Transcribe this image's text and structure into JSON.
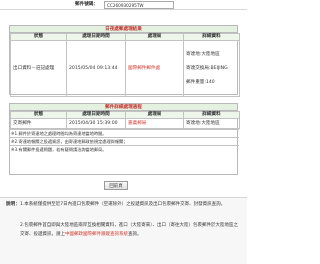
{
  "header": {
    "label": "郵件號碼：",
    "value": "CC260930295TW"
  },
  "daily": {
    "title": "日夜處郵處理結果",
    "columns": [
      "狀態",
      "處理日期時間",
      "處理局",
      "詳細資料"
    ],
    "row": {
      "status": "出口資料－註記處理",
      "datetime": "2015/05/04 09:13:44",
      "office": "國際郵件郵件處",
      "details": [
        "寄達地:大陸地區",
        "寄達交換局:BEIJING",
        "郵件重量:140"
      ]
    }
  },
  "mail": {
    "title": "郵件詳細處理過程",
    "columns": [
      "狀態",
      "處理日期時間",
      "處理局",
      "詳細資料"
    ],
    "rows": [
      {
        "status": "交寄郵件",
        "datetime": "2015/04/30 15:39:00",
        "office": "嘉義郵局",
        "details": "寄達地:大陸地區"
      }
    ],
    "notes": [
      "※1.郵件於寄達地之處理時間均為寄達地當地時間。",
      "※2.寄達地報關之投遞資訊，由寄達地郵政依規定處理與報關；",
      "※3.有關郵件投遞問題，若有疑問請洽詢當地郵局。"
    ]
  },
  "actions": {
    "back": "回前頁"
  },
  "explanation": {
    "heading": "說明：",
    "items": [
      "1.本系統僅提供至近7日內進口包裹郵件（空運除外）之投遞資訊及出口包裹郵件交寄、封發資訊查詢。",
      "2.包裹郵件首自即與大陸地區兩岸互換相關資料，進口（大陸寄來）、出口（寄往大陸）包裹郵件於大陸地區之交寄、投遞資訊，請上",
      "中國郵政國際郵件跟蹤查詢系統",
      "查詢。"
    ],
    "link_color": "#d23a30"
  }
}
